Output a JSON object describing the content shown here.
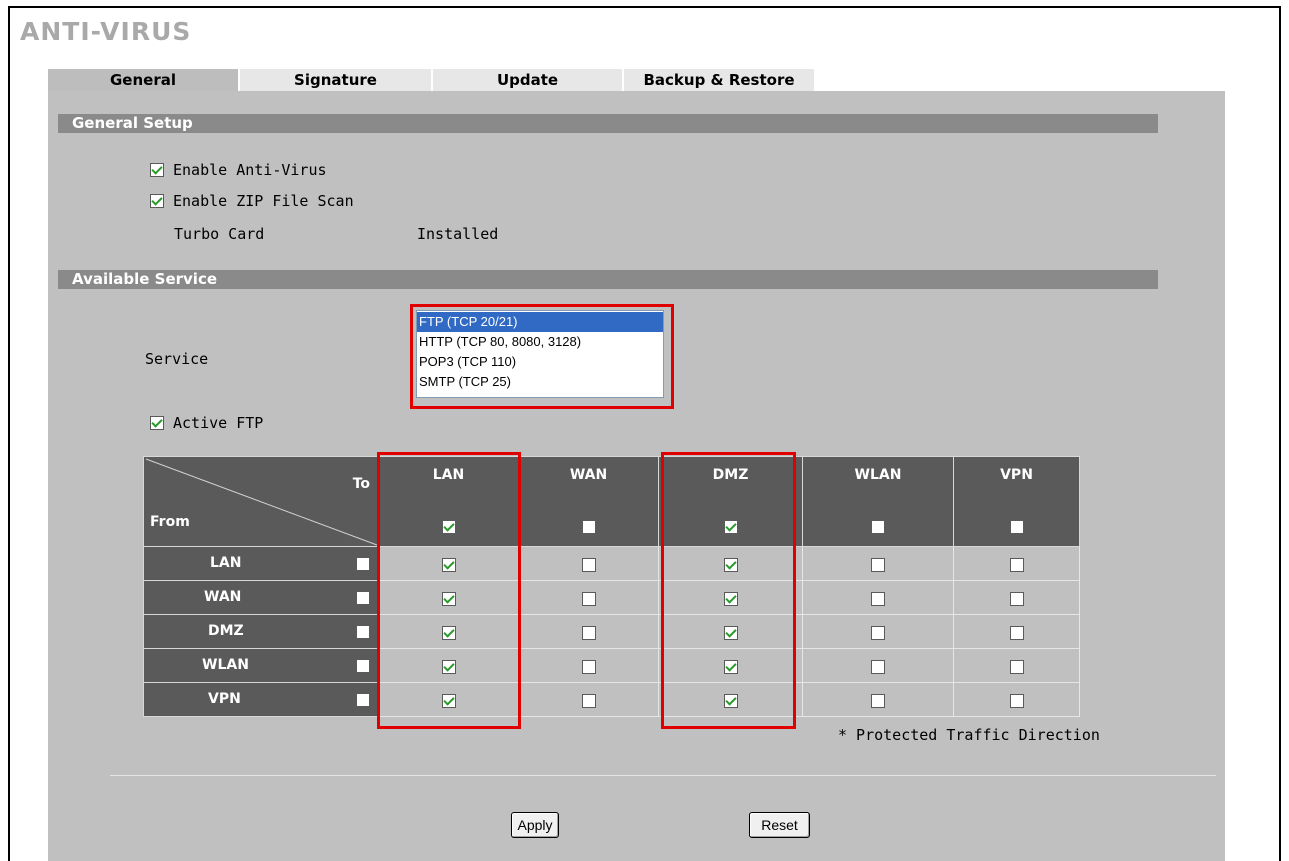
{
  "page": {
    "title": "ANTI-VIRUS"
  },
  "tabs": [
    {
      "label": "General",
      "active": true
    },
    {
      "label": "Signature",
      "active": false
    },
    {
      "label": "Update",
      "active": false
    },
    {
      "label": "Backup & Restore",
      "active": false
    }
  ],
  "general_setup": {
    "heading": "General Setup",
    "enable_antivirus": {
      "label": "Enable Anti-Virus",
      "checked": true
    },
    "enable_zip_scan": {
      "label": "Enable ZIP File Scan",
      "checked": true
    },
    "turbo_card": {
      "label": "Turbo Card",
      "value": "Installed"
    }
  },
  "available_service": {
    "heading": "Available Service",
    "service_label": "Service",
    "service_options": [
      {
        "label": "FTP (TCP 20/21)",
        "selected": true
      },
      {
        "label": "HTTP (TCP 80, 8080, 3128)",
        "selected": false
      },
      {
        "label": "POP3 (TCP 110)",
        "selected": false
      },
      {
        "label": "SMTP (TCP 25)",
        "selected": false
      }
    ],
    "active_ftp": {
      "label": "Active FTP",
      "checked": true
    }
  },
  "matrix": {
    "to_label": "To",
    "from_label": "From",
    "columns": [
      {
        "label": "LAN",
        "all_checked": true
      },
      {
        "label": "WAN",
        "all_checked": false
      },
      {
        "label": "DMZ",
        "all_checked": true
      },
      {
        "label": "WLAN",
        "all_checked": false
      },
      {
        "label": "VPN",
        "all_checked": false
      }
    ],
    "rows": [
      {
        "label": "LAN",
        "row_checked": false,
        "cells": [
          true,
          false,
          true,
          false,
          false
        ]
      },
      {
        "label": "WAN",
        "row_checked": false,
        "cells": [
          true,
          false,
          true,
          false,
          false
        ]
      },
      {
        "label": "DMZ",
        "row_checked": false,
        "cells": [
          true,
          false,
          true,
          false,
          false
        ]
      },
      {
        "label": "WLAN",
        "row_checked": false,
        "cells": [
          true,
          false,
          true,
          false,
          false
        ]
      },
      {
        "label": "VPN",
        "row_checked": false,
        "cells": [
          true,
          false,
          true,
          false,
          false
        ]
      }
    ],
    "footnote": "* Protected Traffic Direction"
  },
  "buttons": {
    "apply": "Apply",
    "reset": "Reset"
  },
  "colors": {
    "highlight": "#e00000",
    "header_dark": "#5a5a5a",
    "panel": "#c0c0c0",
    "section_bar": "#8a8a8a",
    "selection": "#316ac5"
  }
}
